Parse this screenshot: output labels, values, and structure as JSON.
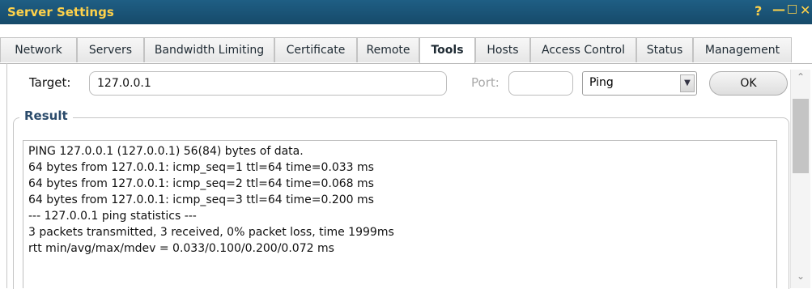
{
  "window": {
    "title": "Server Settings",
    "help_glyph": "?",
    "minimize_glyph": "—",
    "maximize_glyph": "□",
    "close_glyph": "✕"
  },
  "tabs": [
    {
      "label": "Network",
      "active": false
    },
    {
      "label": "Servers",
      "active": false
    },
    {
      "label": "Bandwidth Limiting",
      "active": false
    },
    {
      "label": "Certificate",
      "active": false
    },
    {
      "label": "Remote",
      "active": false
    },
    {
      "label": "Tools",
      "active": true
    },
    {
      "label": "Hosts",
      "active": false
    },
    {
      "label": "Access Control",
      "active": false
    },
    {
      "label": "Status",
      "active": false
    },
    {
      "label": "Management",
      "active": false
    }
  ],
  "tools": {
    "target_label": "Target:",
    "target_value": "127.0.0.1",
    "port_label": "Port:",
    "port_value": "",
    "tool_select": "Ping",
    "ok_label": "OK"
  },
  "result": {
    "legend": "Result",
    "lines": [
      "PING 127.0.0.1 (127.0.0.1) 56(84) bytes of data.",
      "64 bytes from 127.0.0.1: icmp_seq=1 ttl=64 time=0.033 ms",
      "64 bytes from 127.0.0.1: icmp_seq=2 ttl=64 time=0.068 ms",
      "64 bytes from 127.0.0.1: icmp_seq=3 ttl=64 time=0.200 ms",
      "--- 127.0.0.1 ping statistics ---",
      "3 packets transmitted, 3 received, 0% packet loss, time 1999ms",
      "rtt min/avg/max/mdev = 0.033/0.100/0.200/0.072 ms"
    ]
  },
  "colors": {
    "titlebar": "#1b5577",
    "title_text": "#ffd24a",
    "legend_text": "#2b4b6b"
  }
}
